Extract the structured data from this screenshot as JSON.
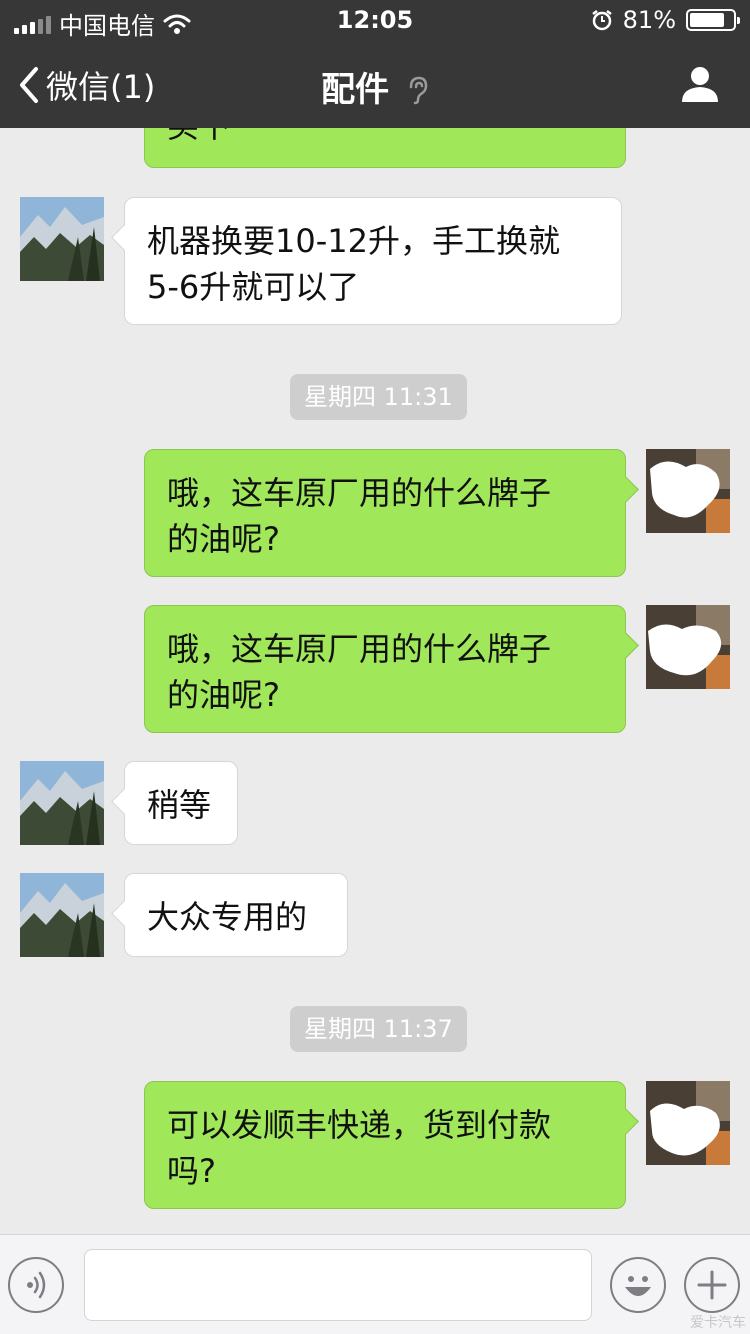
{
  "status_bar": {
    "carrier": "中国电信",
    "time": "12:05",
    "battery_percent": "81%",
    "battery_level": 0.81,
    "icons": [
      "signal-icon",
      "wifi-icon",
      "alarm-icon",
      "battery-icon"
    ]
  },
  "nav": {
    "back_label": "微信(1)",
    "title": "配件",
    "icons": [
      "back-chevron-icon",
      "earpiece-icon",
      "profile-icon"
    ]
  },
  "chat": {
    "top_partial_text": "买下",
    "messages": [
      {
        "type": "in",
        "text_lines": [
          "机器换要10-12升，手工换就",
          "5-6升就可以了"
        ]
      },
      {
        "type": "time",
        "text": "星期四 11:31"
      },
      {
        "type": "out",
        "text_lines": [
          "哦，这车原厂用的什么牌子",
          "的油呢?"
        ]
      },
      {
        "type": "out",
        "text_lines": [
          "哦，这车原厂用的什么牌子",
          "的油呢?"
        ]
      },
      {
        "type": "in",
        "text_lines": [
          "稍等"
        ]
      },
      {
        "type": "in",
        "text_lines": [
          "大众专用的"
        ]
      },
      {
        "type": "time",
        "text": "星期四 11:37"
      },
      {
        "type": "out",
        "text_lines": [
          "可以发顺丰快递，货到付款",
          "吗?"
        ]
      }
    ]
  },
  "input_bar": {
    "text_value": "",
    "icons": [
      "voice-icon",
      "emoji-icon",
      "plus-icon"
    ]
  },
  "watermark": "爱卡汽车",
  "colors": {
    "header": "#373737",
    "chat_bg": "#ebebeb",
    "outgoing_bubble": "#a0e75a",
    "incoming_bubble": "#ffffff",
    "timestamp_bg": "#cecece"
  }
}
